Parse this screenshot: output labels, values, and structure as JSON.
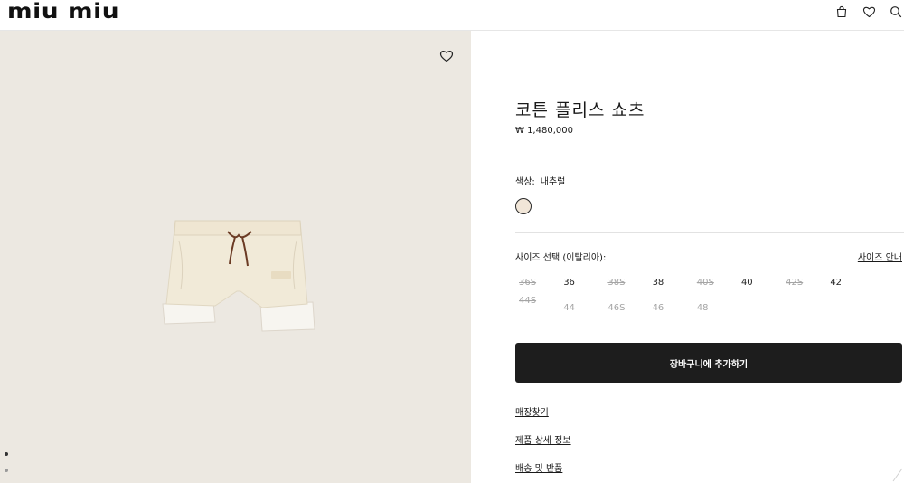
{
  "header": {
    "logo": "miu miu",
    "icons": [
      "bag-icon",
      "heart-icon",
      "search-icon"
    ]
  },
  "gallery": {
    "favorite_icon": "heart-icon",
    "image_alt": "cream cotton fleece shorts with brown drawstring",
    "dots_count": 2
  },
  "product": {
    "title": "코튼 플리스 쇼츠",
    "price": "₩ 1,480,000",
    "color_label": "색상:",
    "color_value": "내추럴",
    "swatch_color": "#f1e6d8",
    "size_label": "사이즈 선택 (이탈리아):",
    "size_guide": "사이즈 안내",
    "sizes": [
      {
        "label": "36S",
        "available": false
      },
      {
        "label": "36",
        "available": true
      },
      {
        "label": "38S",
        "available": false
      },
      {
        "label": "38",
        "available": true
      },
      {
        "label": "40S",
        "available": false
      },
      {
        "label": "40",
        "available": true
      },
      {
        "label": "42S",
        "available": false
      },
      {
        "label": "42",
        "available": true
      },
      {
        "label": "44S",
        "available": false
      },
      {
        "label": "44",
        "available": false
      },
      {
        "label": "46S",
        "available": false
      },
      {
        "label": "46",
        "available": false
      },
      {
        "label": "48",
        "available": false
      }
    ],
    "add_to_cart": "장바구니에 추가하기",
    "links": {
      "store_finder": "매장찾기",
      "details": "제품 상세 정보",
      "shipping": "배송 및 반품"
    }
  },
  "colors": {
    "button_bg": "#1d1d1d",
    "gallery_bg": "#ece8e1",
    "unavailable": "#a5a5a5"
  }
}
